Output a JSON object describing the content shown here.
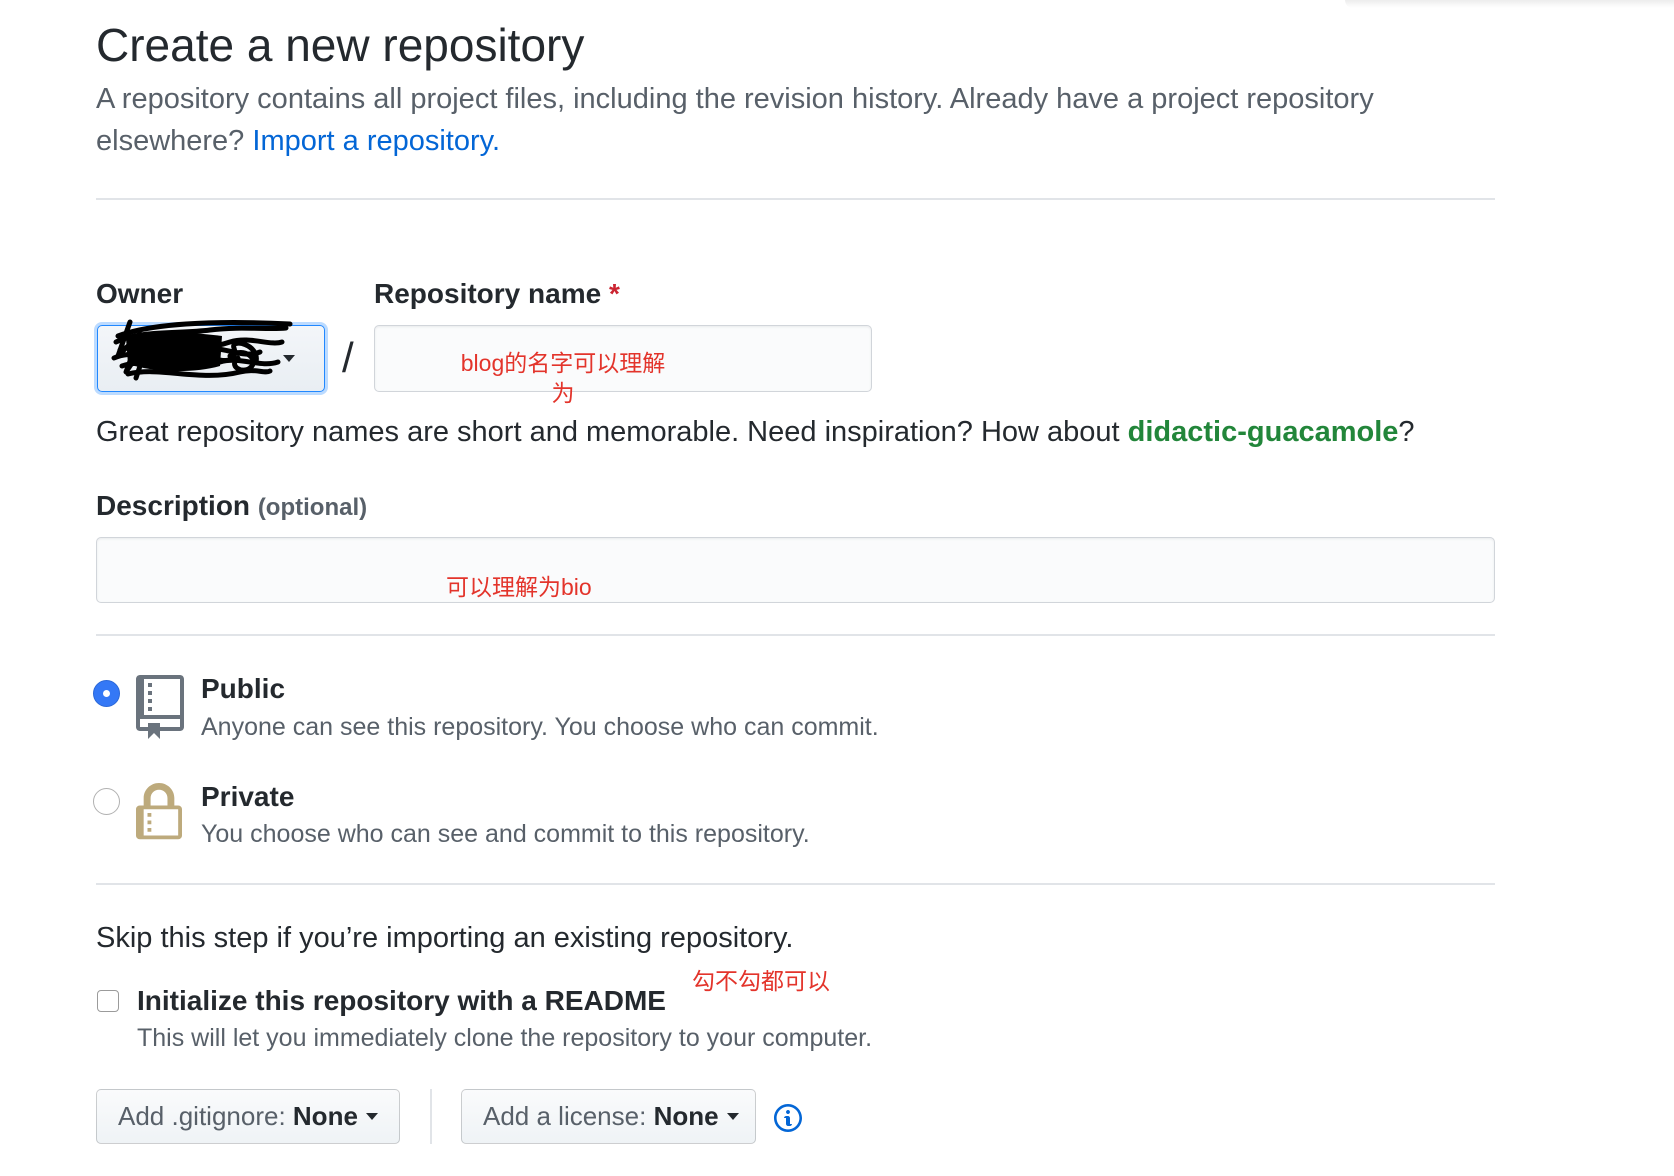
{
  "page": {
    "title": "Create a new repository",
    "subtitle": "A repository contains all project files, including the revision history. Already have a project repository elsewhere?",
    "import_link": "Import a repository."
  },
  "owner": {
    "label": "Owner",
    "value_icon": "scribble-redaction-icon"
  },
  "separator": "/",
  "repo_name": {
    "label": "Repository name",
    "required_mark": "*",
    "value": "",
    "annotation_lines": [
      "blog的名字可以理解",
      "为"
    ]
  },
  "name_hint": {
    "text": "Great repository names are short and memorable. Need inspiration? How about",
    "suggestion": "didactic-guacamole",
    "suffix": "?"
  },
  "description": {
    "label": "Description",
    "optional": "(optional)",
    "value": "",
    "annotation": "可以理解为bio"
  },
  "visibility": {
    "options": [
      {
        "label": "Public",
        "note": "Anyone can see this repository. You choose who can commit.",
        "icon": "repo-icon",
        "checked": true
      },
      {
        "label": "Private",
        "note": "You choose who can see and commit to this repository.",
        "icon": "lock-icon",
        "checked": false
      }
    ]
  },
  "init": {
    "skip_note": "Skip this step if you’re importing an existing repository.",
    "readme_label": "Initialize this repository with a README",
    "readme_note": "This will let you immediately clone the repository to your computer.",
    "readme_checked": false,
    "annotation": "勾不勾都可以"
  },
  "gitignore": {
    "label": "Add .gitignore:",
    "value": "None"
  },
  "license": {
    "label": "Add a license:",
    "value": "None"
  },
  "info_icon": "info-icon",
  "colors": {
    "text": "#24292e",
    "muted": "#586069",
    "link": "#0366d6",
    "suggestion": "#22863a",
    "required": "#cb2431",
    "annotation": "#e3342b",
    "focus": "#2188ff",
    "radio_checked": "#3478f6",
    "lock_icon": "#bdaa7c",
    "repo_icon": "#6a737d",
    "divider": "#e1e4e8",
    "info_icon": "#0366d6"
  }
}
